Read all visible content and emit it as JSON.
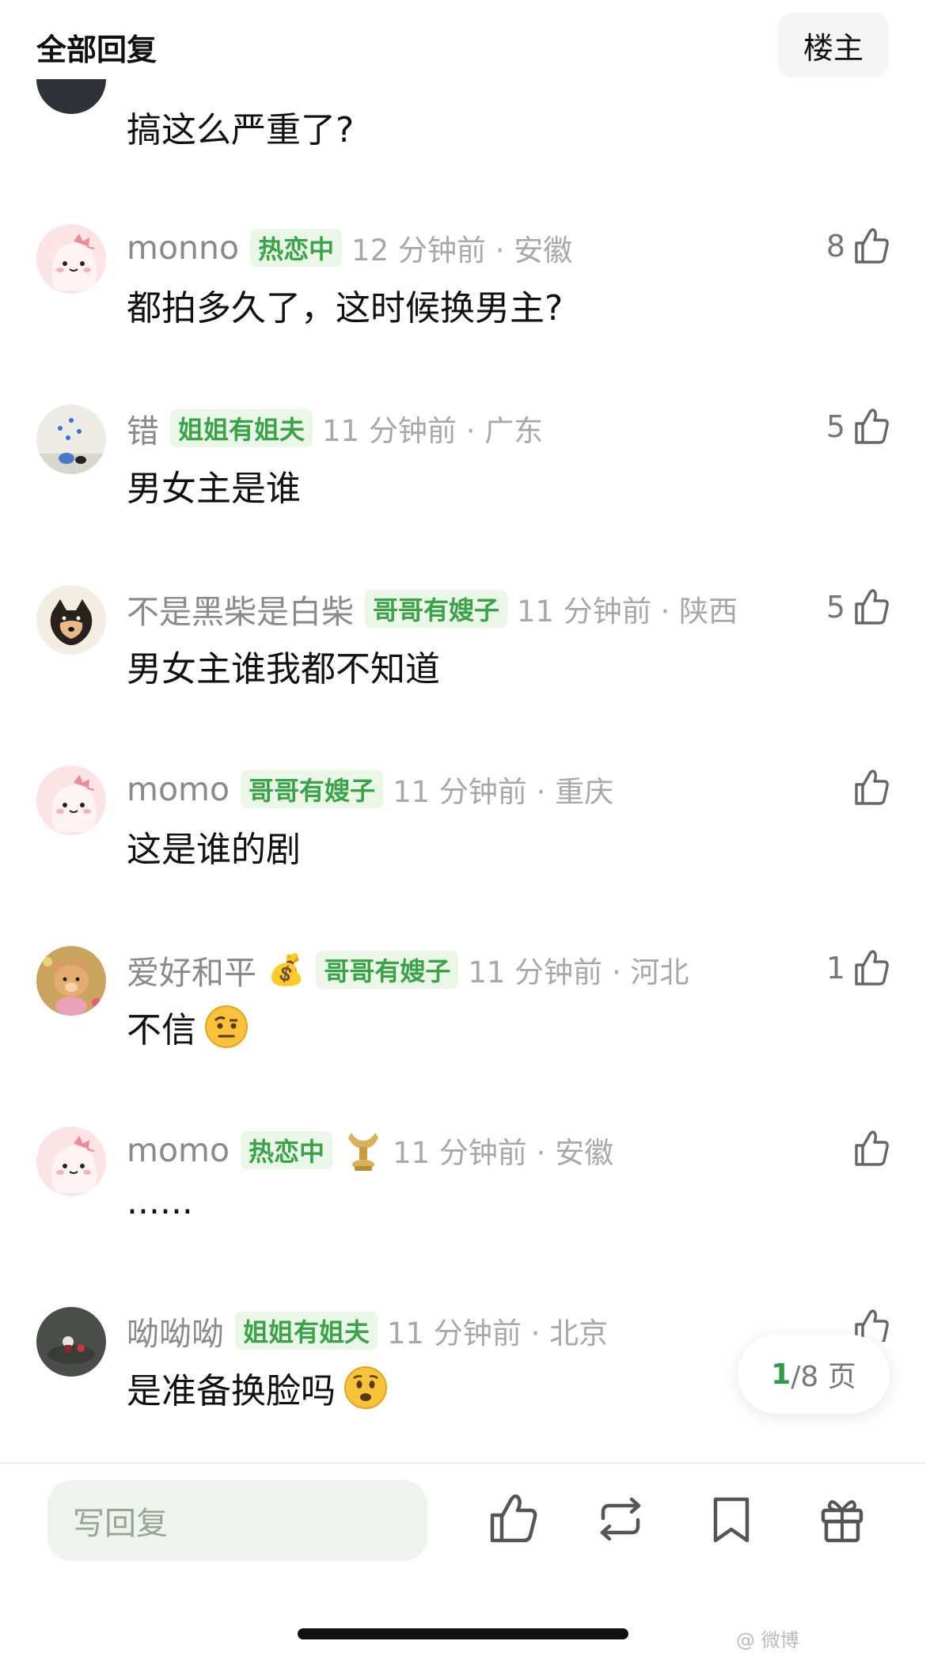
{
  "header": {
    "title": "全部回复",
    "op_button": "楼主"
  },
  "top_comment": {
    "text": "搞这么严重了?"
  },
  "comments": [
    {
      "username": "monno",
      "badge": "热恋中",
      "time": "12 分钟前 · 安徽",
      "likes": "8",
      "text": "都拍多久了，这时候换男主?"
    },
    {
      "username": "错",
      "badge": "姐姐有姐夫",
      "time": "11 分钟前 · 广东",
      "likes": "5",
      "text": "男女主是谁"
    },
    {
      "username": "不是黑柴是白柴",
      "badge": "哥哥有嫂子",
      "time": "11 分钟前 · 陕西",
      "likes": "5",
      "text": "男女主谁我都不知道"
    },
    {
      "username": "momo",
      "badge": "哥哥有嫂子",
      "time": "11 分钟前 · 重庆",
      "likes": "",
      "text": "这是谁的剧"
    },
    {
      "username": "爱好和平",
      "emoji": "💰",
      "badge": "哥哥有嫂子",
      "time": "11 分钟前 · 河北",
      "likes": "1",
      "text": "不信",
      "text_emoji": "raised-eyebrow-face-icon"
    },
    {
      "username": "momo",
      "badge": "热恋中",
      "badge_icon": "golden-trophy-icon",
      "time": "11 分钟前 · 安徽",
      "likes": "",
      "text": "......"
    },
    {
      "username": "呦呦呦",
      "badge": "姐姐有姐夫",
      "time": "11 分钟前 · 北京",
      "likes": "",
      "text": "是准备换脸吗",
      "text_emoji": "frowning-face-icon"
    }
  ],
  "pager": {
    "current": "1",
    "total": "/8 页"
  },
  "bottom_bar": {
    "reply_placeholder": "写回复"
  },
  "watermark": "@ 微博",
  "colors": {
    "badge_bg": "#eaf6e6",
    "badge_text": "#3aa34a",
    "pager_accent": "#2e9d47",
    "input_bg": "#eef3ee"
  }
}
